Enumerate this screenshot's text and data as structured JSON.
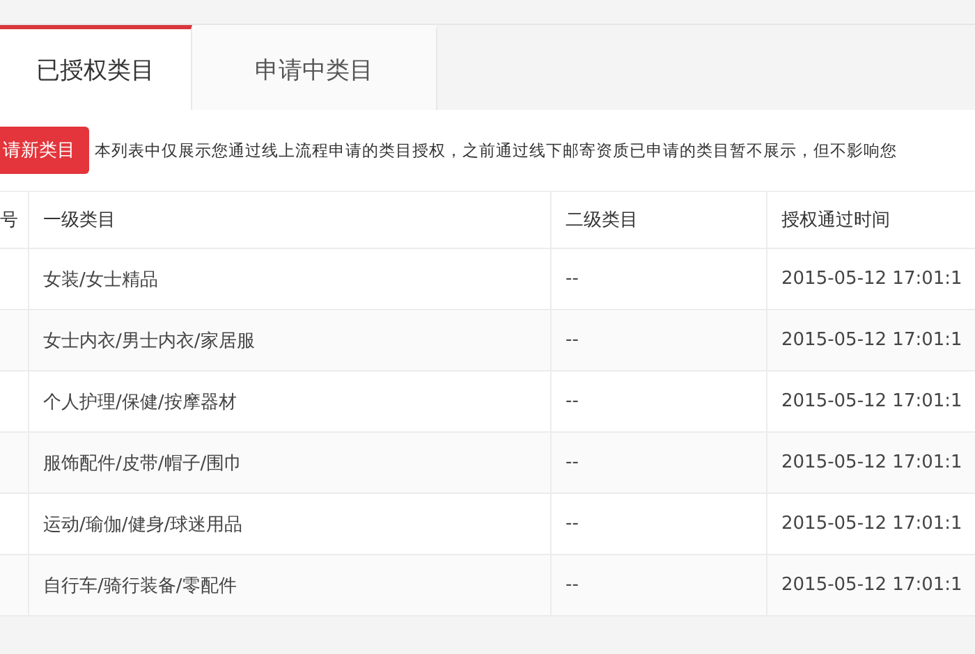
{
  "tabs": [
    {
      "label": "已授权类目",
      "selected": true
    },
    {
      "label": "申请中类目",
      "selected": false
    }
  ],
  "toolbar": {
    "button": "请新类目",
    "notice": "本列表中仅展示您通过线上流程申请的类目授权，之前通过线下邮寄资质已申请的类目暂不展示，但不影响您"
  },
  "table": {
    "columns": [
      "号",
      "一级类目",
      "二级类目",
      "授权通过时间"
    ],
    "rows": [
      [
        "",
        "女装/女士精品",
        "--",
        "2015-05-12 17:01:1"
      ],
      [
        "",
        "女士内衣/男士内衣/家居服",
        "--",
        "2015-05-12 17:01:1"
      ],
      [
        "",
        "个人护理/保健/按摩器材",
        "--",
        "2015-05-12 17:01:1"
      ],
      [
        "",
        "服饰配件/皮带/帽子/围巾",
        "--",
        "2015-05-12 17:01:1"
      ],
      [
        "",
        "运动/瑜伽/健身/球迷用品",
        "--",
        "2015-05-12 17:01:1"
      ],
      [
        "",
        "自行车/骑行装备/零配件",
        "--",
        "2015-05-12 17:01:1"
      ]
    ]
  }
}
